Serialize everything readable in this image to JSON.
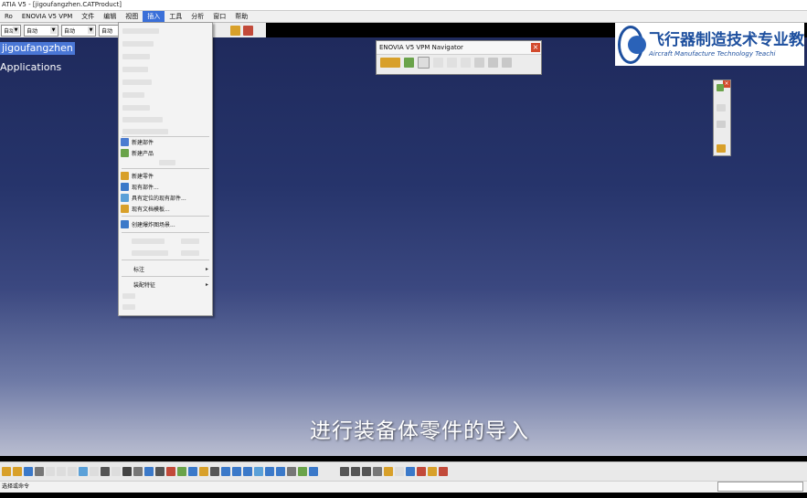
{
  "window": {
    "title": "ATIA V5 - [jigoufangzhen.CATProduct]"
  },
  "menubar": {
    "items": [
      {
        "label": "Ro",
        "active": false
      },
      {
        "label": "ENOVIA V5 VPM",
        "active": false
      },
      {
        "label": "文件",
        "active": false
      },
      {
        "label": "编辑",
        "active": false
      },
      {
        "label": "视图",
        "active": false
      },
      {
        "label": "插入",
        "active": true
      },
      {
        "label": "工具",
        "active": false
      },
      {
        "label": "分析",
        "active": false
      },
      {
        "label": "窗口",
        "active": false
      },
      {
        "label": "帮助",
        "active": false
      }
    ]
  },
  "toolbar": {
    "combos": [
      "自动",
      "自动",
      "自动",
      "自动"
    ]
  },
  "tree": {
    "root_label": "jigoufangzhen",
    "applications_label": "Applications"
  },
  "insert_menu": {
    "items": [
      {
        "label": "新建部件",
        "icon_color": "#4a7bd0"
      },
      {
        "label": "新建产品",
        "icon_color": "#6aa34a"
      },
      {
        "label": "新建零件",
        "icon_color": "#d8a02a"
      },
      {
        "label": "现有部件...",
        "icon_color": "#3b79c9"
      },
      {
        "label": "具有定位的现有部件...",
        "icon_color": "#5aa0d8"
      },
      {
        "label": "现有文档模板...",
        "icon_color": "#d8a02a"
      },
      {
        "label": "创建爆炸图场景...",
        "icon_color": "#3b79c9"
      },
      {
        "label": "标注",
        "submenu": true
      },
      {
        "label": "装配特征",
        "submenu": true
      }
    ]
  },
  "navigator": {
    "title": "ENOVIA V5 VPM Navigator"
  },
  "logo": {
    "cn": "飞行器制造技术专业教",
    "en": "Aircraft Manufacture Technology Teachi"
  },
  "subtitle": "进行装备体零件的导入",
  "statusbar": {
    "text": "选择或命令"
  }
}
